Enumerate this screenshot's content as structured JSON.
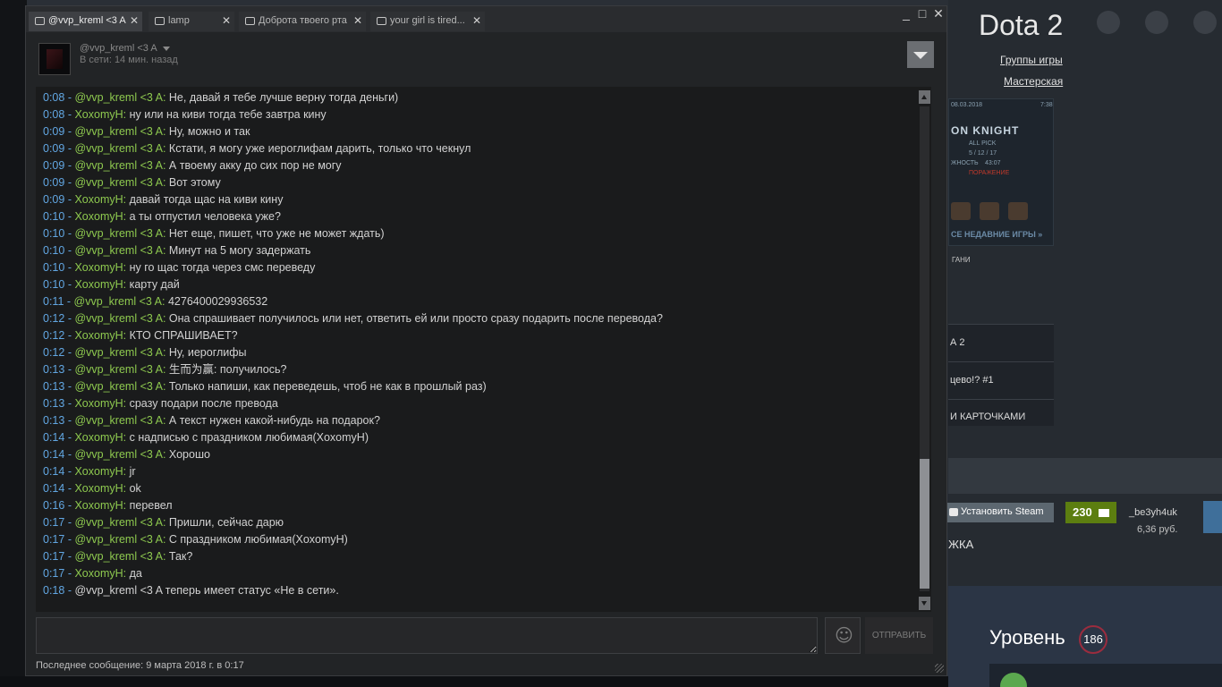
{
  "background": {
    "game_title": "Dota 2",
    "links": [
      "Группы игры",
      "Мастерская"
    ],
    "game_card": {
      "date": "08.03.2018",
      "time": "7:38",
      "hero": "ON KNIGHT",
      "mode": "ALL PICK",
      "kda": "5 / 12 / 17",
      "duration_label": "ЖНОСТЬ",
      "duration": "43:07",
      "result": "ПОРАЖЕНИЕ",
      "recent": "СЕ НЕДАВНИЕ ИГРЫ »",
      "under": "ГАНИ"
    },
    "blocks": [
      "А 2",
      "цево!? #1",
      "И КАРТОЧКАМИ"
    ],
    "install_label": "Установить Steam",
    "notifications": "230",
    "username": "_be3yh4uk",
    "balance": "6,36 руб.",
    "section": "ЖКА",
    "level_label": "Уровень",
    "level_value": "186"
  },
  "window": {
    "tabs": [
      {
        "label": "@vvp_kreml <3 A"
      },
      {
        "label": "lamp"
      },
      {
        "label": "Доброта твоего рта"
      },
      {
        "label": "your girl is tired..."
      }
    ],
    "controls": [
      "_",
      "□",
      "✕"
    ],
    "friend_name": "@vvp_kreml <3 A",
    "friend_status": "В сети: 14 мин. назад",
    "send_label": "ОТПРАВИТЬ",
    "footer": "Последнее сообщение: 9 марта 2018 г. в 0:17",
    "input_value": ""
  },
  "messages": [
    {
      "time": "0:08",
      "name": "@vvp_kreml <3 A",
      "text": "Не, давай я тебе лучше верну тогда деньги)"
    },
    {
      "time": "0:08",
      "name": "XoxomyH",
      "text": "ну или на киви тогда тебе завтра кину"
    },
    {
      "time": "0:09",
      "name": "@vvp_kreml <3 A",
      "text": "Ну, можно и так"
    },
    {
      "time": "0:09",
      "name": "@vvp_kreml <3 A",
      "text": "Кстати, я могу уже иероглифам дарить, только что чекнул"
    },
    {
      "time": "0:09",
      "name": "@vvp_kreml <3 A",
      "text": "А твоему акку до сих пор не могу"
    },
    {
      "time": "0:09",
      "name": "@vvp_kreml <3 A",
      "text": "Вот этому"
    },
    {
      "time": "0:09",
      "name": "XoxomyH",
      "text": "давай тогда щас на киви кину"
    },
    {
      "time": "0:10",
      "name": "XoxomyH",
      "text": "а ты отпустил человека уже?"
    },
    {
      "time": "0:10",
      "name": "@vvp_kreml <3 A",
      "text": "Нет еще, пишет, что уже не может ждать)"
    },
    {
      "time": "0:10",
      "name": "@vvp_kreml <3 A",
      "text": "Минут на 5 могу задержать"
    },
    {
      "time": "0:10",
      "name": "XoxomyH",
      "text": "ну го щас тогда через смс переведу"
    },
    {
      "time": "0:10",
      "name": "XoxomyH",
      "text": "карту дай"
    },
    {
      "time": "0:11",
      "name": "@vvp_kreml <3 A",
      "text": "4276400029936532"
    },
    {
      "time": "0:12",
      "name": "@vvp_kreml <3 A",
      "text": "Она спрашивает получилось или нет, ответить ей или просто сразу подарить после перевода?"
    },
    {
      "time": "0:12",
      "name": "XoxomyH",
      "text": "КТО СПРАШИВАЕТ?"
    },
    {
      "time": "0:12",
      "name": "@vvp_kreml <3 A",
      "text": "Ну, иероглифы"
    },
    {
      "time": "0:13",
      "name": "@vvp_kreml <3 A",
      "text": "生而为赢: получилось?"
    },
    {
      "time": "0:13",
      "name": "@vvp_kreml <3 A",
      "text": "Только напиши, как переведешь, чтоб не как в прошлый раз)"
    },
    {
      "time": "0:13",
      "name": "XoxomyH",
      "text": "сразу подари после превода"
    },
    {
      "time": "0:13",
      "name": "@vvp_kreml <3 A",
      "text": "А текст нужен какой-нибудь на подарок?"
    },
    {
      "time": "0:14",
      "name": "XoxomyH",
      "text": "с надписью с праздником любимая(XoxomyH)"
    },
    {
      "time": "0:14",
      "name": "@vvp_kreml <3 A",
      "text": "Хорошо"
    },
    {
      "time": "0:14",
      "name": "XoxomyH",
      "text": "jr"
    },
    {
      "time": "0:14",
      "name": "XoxomyH",
      "text": "ok"
    },
    {
      "time": "0:16",
      "name": "XoxomyH",
      "text": "перевел"
    },
    {
      "time": "0:17",
      "name": "@vvp_kreml <3 A",
      "text": "Пришли, сейчас дарю"
    },
    {
      "time": "0:17",
      "name": "@vvp_kreml <3 A",
      "text": "С праздником любимая(XoxomyH)"
    },
    {
      "time": "0:17",
      "name": "@vvp_kreml <3 A",
      "text": "Так?"
    },
    {
      "time": "0:17",
      "name": "XoxomyH",
      "text": "да"
    }
  ],
  "system_message": {
    "time": "0:18",
    "text": "@vvp_kreml <3 A теперь имеет статус «Не в сети»."
  }
}
